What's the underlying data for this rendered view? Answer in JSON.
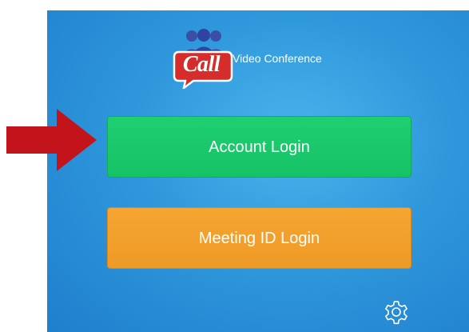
{
  "app": {
    "logo_text": "Call",
    "name": "Video Conference"
  },
  "buttons": {
    "account_login": "Account Login",
    "meeting_id_login": "Meeting ID Login"
  },
  "icons": {
    "settings": "gear-icon",
    "annotation": "arrow-right-icon",
    "logo_people": "people-group-icon"
  },
  "colors": {
    "background": "#2f98dc",
    "account_login_button": "#1bc86b",
    "meeting_id_login_button": "#f2a02c",
    "logo_bubble": "#d42d2b",
    "logo_people": "#3b4fa6",
    "arrow": "#c4141b"
  }
}
